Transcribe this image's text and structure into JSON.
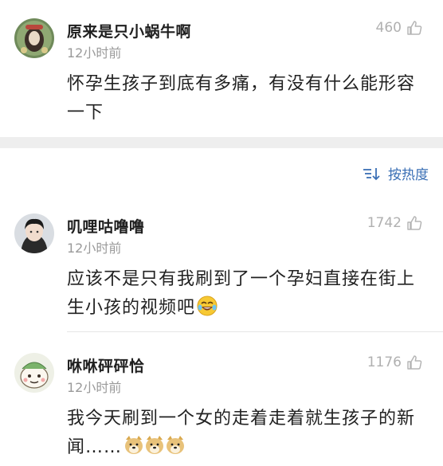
{
  "post": {
    "username": "原来是只小蜗牛啊",
    "time": "12小时前",
    "likes": "460",
    "text": "怀孕生孩子到底有多痛，有没有什么能形容一下",
    "avatar_icon": "avatar-icon"
  },
  "sort": {
    "label": "按热度",
    "icon": "sort-icon"
  },
  "comments": [
    {
      "username": "叽哩咕噜噜",
      "time": "12小时前",
      "likes": "1742",
      "text": "应该不是只有我刷到了一个孕妇直接在街上生小孩的视频吧",
      "emoji": "laughing-tears-emoji"
    },
    {
      "username": "咻咻砰砰恰",
      "time": "12小时前",
      "likes": "1176",
      "text": "我今天刷到一个女的走着走着就生孩子的新闻……",
      "emoji": "doge-emoji"
    }
  ],
  "colors": {
    "accent": "#3a6fb5",
    "muted": "#9a9a9a",
    "band": "#eeeeee"
  }
}
